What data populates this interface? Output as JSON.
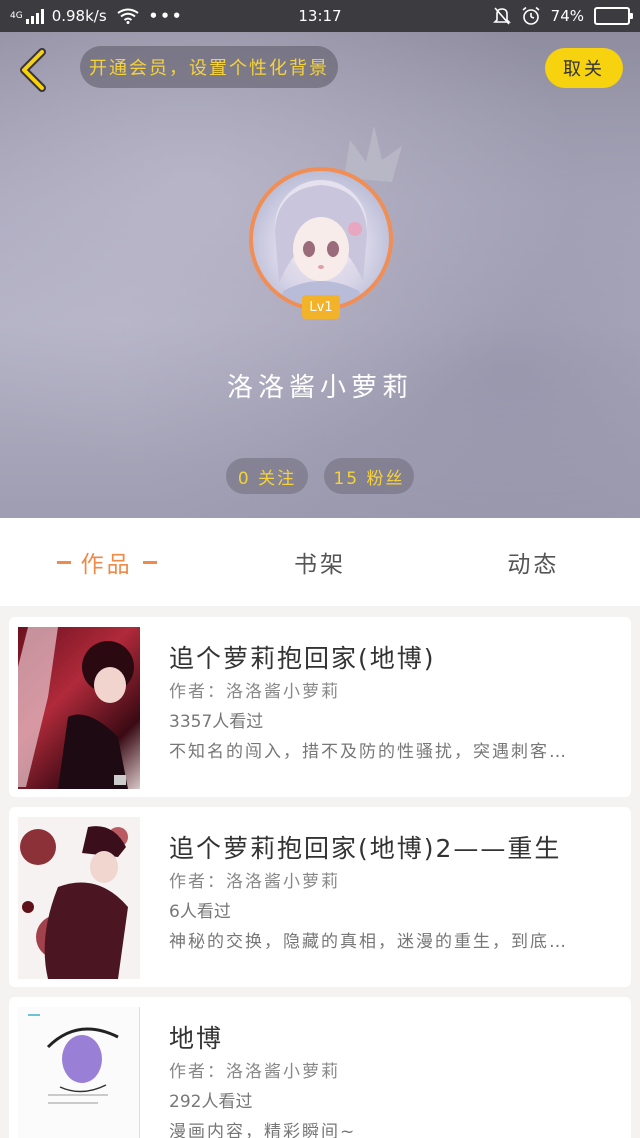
{
  "status_bar": {
    "network_type": "4G",
    "speed": "0.98k/s",
    "more": "•••",
    "time": "13:17",
    "battery": "74%",
    "battery_fraction": 0.74
  },
  "header": {
    "vip_prompt": "开通会员，设置个性化背景",
    "unfollow_label": "取关",
    "level": "Lv1",
    "username": "洛洛酱小萝莉",
    "following": "0 关注",
    "fans": "15 粉丝"
  },
  "tabs": {
    "works": "作品",
    "bookshelf": "书架",
    "activity": "动态"
  },
  "works": [
    {
      "title": "追个萝莉抱回家(地博)",
      "author": "作者：洛洛酱小萝莉",
      "views": "3357人看过",
      "description": "不知名的闯入，措不及防的性骚扰，突遇刺客…"
    },
    {
      "title": "追个萝莉抱回家(地博)2——重生",
      "author": "作者：洛洛酱小萝莉",
      "views": "6人看过",
      "description": "神秘的交换，隐藏的真相，迷漫的重生，到底…"
    },
    {
      "title": "地博",
      "author": "作者：洛洛酱小萝莉",
      "views": "292人看过",
      "description": "漫画内容，精彩瞬间~"
    }
  ]
}
